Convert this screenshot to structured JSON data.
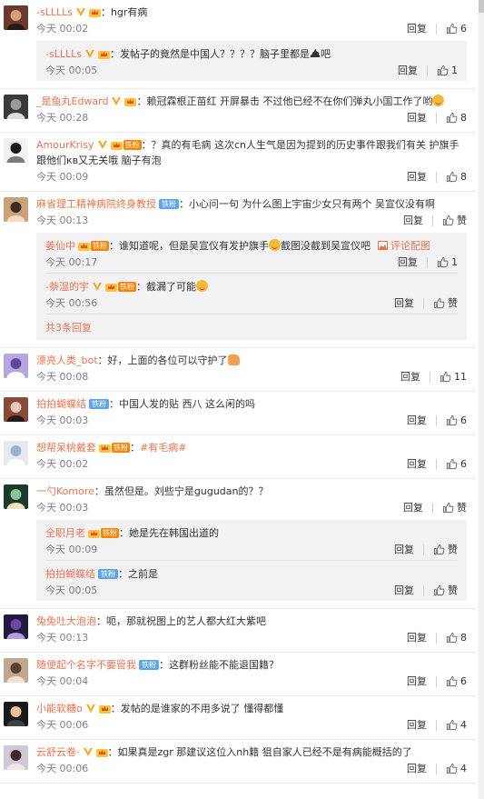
{
  "ui": {
    "reply": "回复",
    "like_zero": "赞"
  },
  "comments": [
    {
      "user": "-sLLLLs",
      "text": "hgr有病",
      "time": "今天 00:02",
      "likes": "6",
      "badges": [
        "v",
        "crown"
      ],
      "replies": [
        {
          "user": "-sLLLLs",
          "text": "发帖子的竟然是中国人？？？？脑子里都是",
          "emoji_after": "poop",
          "suffix": "吧",
          "time": "今天 00:05",
          "likes": "1",
          "badges": [
            "v",
            "crown"
          ]
        }
      ]
    },
    {
      "user": "_是鱼丸Edward",
      "text": "赖冠霖根正苗红  开屏暴击 不过他已经不在你们弹丸小国工作了哟",
      "emoji_after": "grin",
      "time": "今天 00:28",
      "likes": "8",
      "badges": [
        "v",
        "crown"
      ]
    },
    {
      "user": "AmourKrisy",
      "text": "？真的有毛病 这次cn人生气是因为提到的历史事件跟我们有关 护旗手跟他们кв又无关哦 脑子有泡",
      "time": "今天 00:09",
      "likes": "8",
      "badges": [
        "v",
        "crown",
        "fan"
      ],
      "fan": "铁粉"
    },
    {
      "user": "麻省理工精神病院终身教授",
      "text": "小心问一句 为什么图上宇宙少女只有两个 吴宣仪没有啊",
      "time": "今天 00:13",
      "likes": "赞",
      "badges": [
        "vip"
      ],
      "vip": "铁粉",
      "replies": [
        {
          "user": "姜仙中",
          "text": "谁知道呢，但是吴宣仪有发护旗手",
          "emoji_after": "grin",
          "suffix": "截图没截到吴宣仪吧",
          "extra": "评论配图",
          "time": "今天 00:17",
          "likes": "1",
          "badges": [
            "crown",
            "fan"
          ],
          "fan": "铁粉"
        },
        {
          "user": "-萘湿的宇",
          "text": "截漏了可能",
          "emoji_after": "grin",
          "time": "今天 00:56",
          "likes": "赞",
          "badges": [
            "v",
            "crown",
            "fan"
          ],
          "fan": "铁粉"
        }
      ],
      "more": "共3条回复"
    },
    {
      "user": "漂亮人类_bot",
      "text": "好，上面的各位可以守护了",
      "emoji_after": "fist",
      "time": "今天 00:08",
      "likes": "11",
      "badges": []
    },
    {
      "user": "拍拍蝴蝶结",
      "text": "中国人发的贴 西八 这么闲的吗",
      "time": "今天 00:03",
      "likes": "6",
      "badges": [
        "vip"
      ],
      "vip": "铁粉"
    },
    {
      "user": "想帮呆桃戴套",
      "text": "",
      "link": "#有毛病#",
      "time": "今天 00:02",
      "likes": "6",
      "badges": [
        "crown",
        "fan"
      ],
      "fan": "铁粉"
    },
    {
      "user": "一勺Komore",
      "text": "虽然但是。刘些宁是gugudan的？？",
      "time": "今天 00:03",
      "likes": "赞",
      "badges": [],
      "replies": [
        {
          "user": "全职月老",
          "text": "她是先在韩国出道的",
          "time": "今天 00:09",
          "likes": "赞",
          "badges": [
            "crown",
            "fan"
          ],
          "fan": "铁粉"
        },
        {
          "user": "拍拍蝴蝶结",
          "text": "之前是",
          "time": "今天 00:05",
          "likes": "赞",
          "badges": [
            "vip"
          ],
          "vip": "铁粉"
        }
      ]
    },
    {
      "user": "兔兔吐大泡泡",
      "text": "呃，那就祝图上的艺人都大红大紫吧",
      "time": "今天 00:13",
      "likes": "8",
      "badges": []
    },
    {
      "user": "随便起个名字不要管我",
      "text": "这群粉丝能不能退国籍？",
      "time": "今天 00:04",
      "likes": "6",
      "badges": [
        "vip"
      ],
      "vip": "铁粉"
    },
    {
      "user": "小能软糖o",
      "text": "发帖的是谁家的不用多说了 懂得都懂",
      "time": "今天 00:06",
      "likes": "4",
      "badges": [
        "v",
        "crown"
      ]
    },
    {
      "user": "云舒云卷·",
      "text": "如果真是zgr 那建议这位入nh籍 狙自家人已经不是有病能概括的了",
      "time": "今天 00:06",
      "likes": "4",
      "badges": [
        "v",
        "crown"
      ]
    }
  ],
  "colors": {
    "username": "#eb7350",
    "subbox": "#f2f2f5",
    "verified": "#f5a623",
    "fan": "#ff8200",
    "vip": "#5da5e8"
  }
}
